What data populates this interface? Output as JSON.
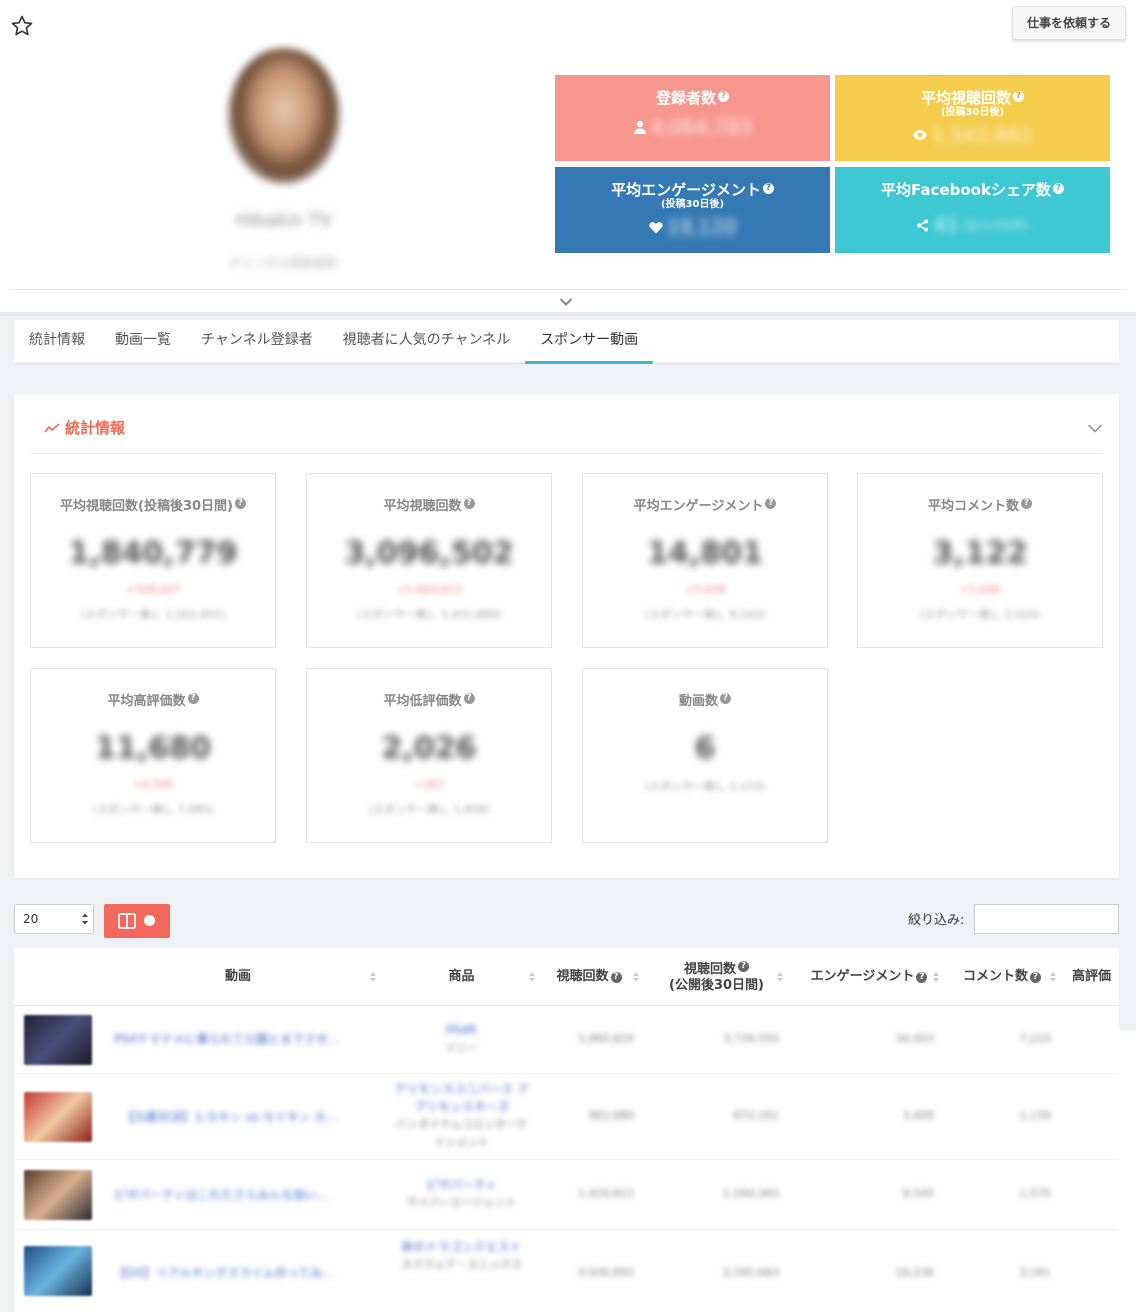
{
  "header": {
    "request_button": "仕事を依頼する",
    "channel_name": "Hikakin TV",
    "channel_sub": "チャンネル登録者数"
  },
  "summary": {
    "subscribers": {
      "title": "登録者数",
      "value": "4,064,783",
      "icon": "user-icon"
    },
    "avg_views": {
      "title": "平均視聴回数",
      "subtitle": "(投稿30日後)",
      "value": "1,542,661",
      "icon": "eye-icon"
    },
    "avg_engagement": {
      "title": "平均エンゲージメント",
      "subtitle": "(投稿30日後)",
      "value": "19,120",
      "icon": "heart-icon"
    },
    "avg_facebook": {
      "title": "平均Facebookシェア数",
      "value": "41",
      "value_note": "(全 6,434件)",
      "icon": "share-icon"
    }
  },
  "tabs": [
    {
      "label": "統計情報"
    },
    {
      "label": "動画一覧"
    },
    {
      "label": "チャンネル登録者"
    },
    {
      "label": "視聴者に人気のチャンネル"
    },
    {
      "label": "スポンサー動画",
      "active": true
    }
  ],
  "stats": {
    "title": "統計情報",
    "cards": [
      {
        "title": "平均視聴回数(投稿後30日間)",
        "value": "1,840,779",
        "delta": "+328,007",
        "sub": "(スポンサー無し 1,261,651)"
      },
      {
        "title": "平均視聴回数",
        "value": "3,096,502",
        "delta": "+1,664,613",
        "sub": "(スポンサー無し 1,431,889)"
      },
      {
        "title": "平均エンゲージメント",
        "value": "14,801",
        "delta": "+5,638",
        "sub": "(スポンサー無し 9,163)"
      },
      {
        "title": "平均コメント数",
        "value": "3,122",
        "delta": "+1,098",
        "sub": "(スポンサー無し 2,024)"
      },
      {
        "title": "平均高評価数",
        "value": "11,680",
        "delta": "+4,595",
        "sub": "(スポンサー無し 7,085)"
      },
      {
        "title": "平均低評価数",
        "value": "2,026",
        "delta": "+367",
        "sub": "(スポンサー無し 1,659)"
      },
      {
        "title": "動画数",
        "value": "6",
        "delta": "",
        "sub": "(スポンサー無し 2,153)"
      }
    ]
  },
  "table_controls": {
    "per_page": "20",
    "filter_label": "絞り込み:"
  },
  "table": {
    "headers": [
      "動画",
      "商品",
      "視聴回数",
      "視聴回数",
      "(公開後30日間)",
      "エンゲージメント",
      "コメント数",
      "高評価"
    ],
    "rows": [
      {
        "title": "PS4ヤマナメに乗られて公園とまでさせ…",
        "product": "PS4R",
        "maker": "ソニー",
        "views": "5,965,824",
        "views30": "3,734,555",
        "engagement": "34,453",
        "comments": "7,215",
        "thumb": "#3a3f5a"
      },
      {
        "title": "【元素対決】ヒカキン vs セイキン 大…",
        "product": "アリモンスユニバース アプリモンスターズ",
        "maker": "バンダイナムコエンターテインメント",
        "views": "962,680",
        "views30": "872,161",
        "engagement": "3,409",
        "comments": "1,130",
        "thumb": "#b8322e"
      },
      {
        "title": "ピザパーティはこれたさらみんな自い…",
        "product": "ピザパーティ",
        "maker": "サイバーエージェント",
        "views": "1,429,912",
        "views30": "1,200,383",
        "engagement": "8,545",
        "comments": "1,575",
        "thumb": "#6b4d3a"
      },
      {
        "title": "【DX】リアルキングスライム作ってみ…",
        "product": "新のドラゴンクエスト",
        "maker": "スクウェア・エニックス",
        "views": "4,936,993",
        "views30": "2,395,663",
        "engagement": "16,236",
        "comments": "3,161",
        "thumb": "#2f6fa8"
      }
    ]
  }
}
